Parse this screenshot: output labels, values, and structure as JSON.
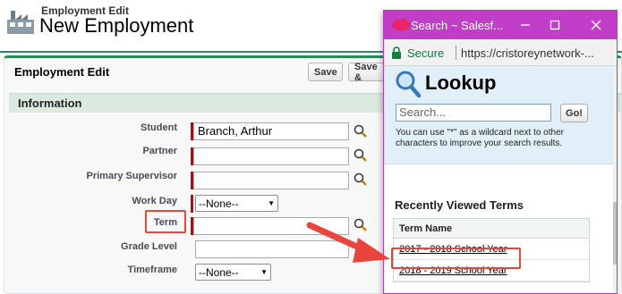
{
  "page": {
    "subtitle": "Employment Edit",
    "title": "New Employment"
  },
  "panel": {
    "title": "Employment Edit",
    "save_label": "Save",
    "save_and_label": "Save &"
  },
  "section": {
    "title": "Information"
  },
  "fields": {
    "student_label": "Student",
    "student_value": "Branch, Arthur",
    "partner_label": "Partner",
    "partner_value": "",
    "primary_supervisor_label": "Primary Supervisor",
    "primary_supervisor_value": "",
    "work_day_label": "Work Day",
    "work_day_value": "--None--",
    "term_label": "Term",
    "term_value": "",
    "grade_level_label": "Grade Level",
    "grade_level_value": "",
    "timeframe_label": "Timeframe",
    "timeframe_value": "--None--"
  },
  "popup": {
    "window_title": "Search ~ Salesf...",
    "secure_label": "Secure",
    "url": "https://cristoreynetwork-...",
    "heading": "Lookup",
    "search_placeholder": "Search...",
    "go_label": "Go!",
    "help_line1": "You can use \"*\" as a wildcard next to other",
    "help_line2": "characters to improve your search results.",
    "recent_heading": "Recently Viewed Terms",
    "table_header": "Term Name",
    "rows": [
      "2017 - 2018 School Year",
      "2018 - 2019 School Year"
    ]
  },
  "colors": {
    "accent_green": "#2d8a58",
    "popup_titlebar": "#c13ec8",
    "highlight_red": "#e8463c",
    "required_red": "#cc0000"
  }
}
